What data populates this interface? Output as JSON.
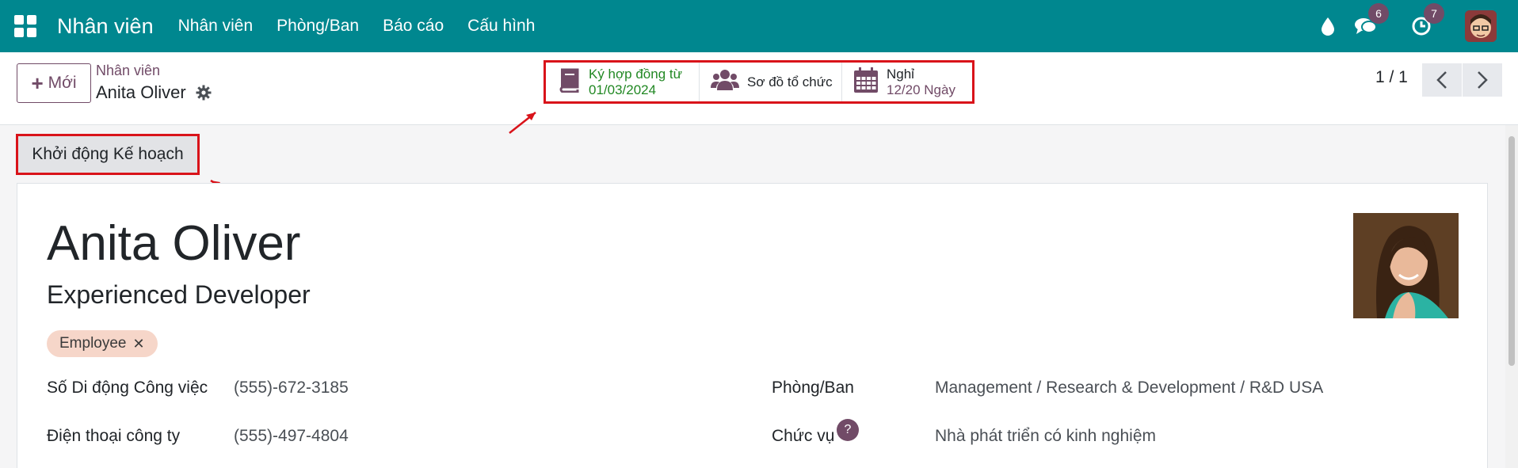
{
  "navbar": {
    "app_title": "Nhân viên",
    "menu": [
      "Nhân viên",
      "Phòng/Ban",
      "Báo cáo",
      "Cấu hình"
    ],
    "message_count": "6",
    "activity_count": "7"
  },
  "control": {
    "new_label": "Mới",
    "breadcrumb_parent": "Nhân viên",
    "breadcrumb_current": "Anita Oliver",
    "pager": "1 / 1"
  },
  "smart_buttons": {
    "contract_line1": "Ký hợp đồng từ",
    "contract_line2": "01/03/2024",
    "org_chart": "Sơ đồ tổ chức",
    "leave_line1": "Nghỉ",
    "leave_line2": "12/20 Ngày"
  },
  "actions": {
    "launch_plan": "Khởi động Kế hoạch"
  },
  "employee": {
    "name": "Anita Oliver",
    "job_title": "Experienced Developer",
    "tag": "Employee"
  },
  "fields": {
    "work_mobile_label": "Số Di động Công việc",
    "work_mobile_value": "(555)-672-3185",
    "work_phone_label": "Điện thoại công ty",
    "work_phone_value": "(555)-497-4804",
    "department_label": "Phòng/Ban",
    "department_value": "Management / Research & Development / R&D USA",
    "job_position_label": "Chức vụ",
    "job_position_value": "Nhà phát triển có kinh nghiệm",
    "help_mark": "?"
  },
  "colors": {
    "navbar": "#00878f",
    "brand_purple": "#714b67",
    "highlight_red": "#d9131a",
    "contract_green": "#218823",
    "tag_bg": "#f6d6c9"
  }
}
